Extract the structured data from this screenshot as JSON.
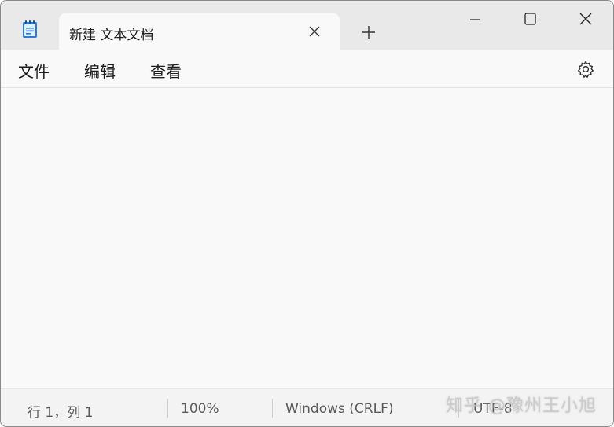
{
  "tab": {
    "title": "新建 文本文档"
  },
  "window_controls": {
    "minimize": "minimize",
    "maximize": "maximize",
    "close": "close"
  },
  "menu": {
    "file": "文件",
    "edit": "编辑",
    "view": "查看"
  },
  "editor": {
    "content": ""
  },
  "status": {
    "position": "行 1，列 1",
    "zoom": "100%",
    "line_ending": "Windows (CRLF)",
    "encoding": "UTF-8"
  },
  "watermark": "知乎 @豫州王小旭",
  "icons": {
    "app": "notepad-icon",
    "tab_close": "close-icon",
    "new_tab": "plus-icon",
    "settings": "gear-icon"
  },
  "colors": {
    "titlebar": "#e9e9e9",
    "background": "#f9f9f9",
    "text": "#1b1b1b"
  }
}
